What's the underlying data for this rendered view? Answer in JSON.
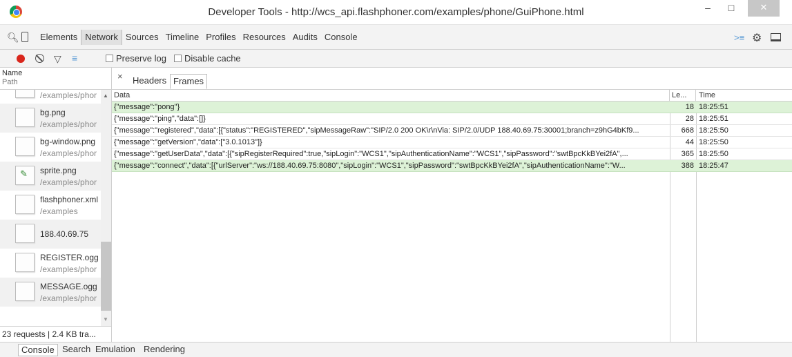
{
  "window": {
    "title": "Developer Tools - http://wcs_api.flashphoner.com/examples/phone/GuiPhone.html",
    "minimize": "–",
    "maximize": "□",
    "close": "✕"
  },
  "toolbar": {
    "tabs": [
      "Elements",
      "Network",
      "Sources",
      "Timeline",
      "Profiles",
      "Resources",
      "Audits",
      "Console"
    ],
    "active_tab": "Network"
  },
  "network_toolbar": {
    "preserve_log_label": "Preserve log",
    "disable_cache_label": "Disable cache",
    "preserve_log_checked": false,
    "disable_cache_checked": false
  },
  "request_list": {
    "header_name": "Name",
    "header_path": "Path",
    "items": [
      {
        "name": "",
        "path": "/examples/phor"
      },
      {
        "name": "bg.png",
        "path": "/examples/phor"
      },
      {
        "name": "bg-window.png",
        "path": "/examples/phor"
      },
      {
        "name": "sprite.png",
        "path": "/examples/phor"
      },
      {
        "name": "flashphoner.xml",
        "path": "/examples"
      },
      {
        "name": "188.40.69.75",
        "path": ""
      },
      {
        "name": "REGISTER.ogg",
        "path": "/examples/phor"
      },
      {
        "name": "MESSAGE.ogg",
        "path": "/examples/phor"
      }
    ],
    "status": "23 requests | 2.4 KB tra..."
  },
  "detail": {
    "close": "×",
    "tabs": [
      "Headers",
      "Frames"
    ],
    "active_tab": "Frames"
  },
  "frames": {
    "columns": [
      "Data",
      "Le...",
      "Time"
    ],
    "rows": [
      {
        "data": "{\"message\":\"pong\"}",
        "length": "18",
        "time": "18:25:51",
        "direction": "sent"
      },
      {
        "data": "{\"message\":\"ping\",\"data\":[]}",
        "length": "28",
        "time": "18:25:51",
        "direction": "received"
      },
      {
        "data": "{\"message\":\"registered\",\"data\":[{\"status\":\"REGISTERED\",\"sipMessageRaw\":\"SIP/2.0 200 OK\\r\\nVia: SIP/2.0/UDP 188.40.69.75:30001;branch=z9hG4bKf9...",
        "length": "668",
        "time": "18:25:50",
        "direction": "received"
      },
      {
        "data": "{\"message\":\"getVersion\",\"data\":[\"3.0.1013\"]}",
        "length": "44",
        "time": "18:25:50",
        "direction": "received"
      },
      {
        "data": "{\"message\":\"getUserData\",\"data\":[{\"sipRegisterRequired\":true,\"sipLogin\":\"WCS1\",\"sipAuthenticationName\":\"WCS1\",\"sipPassword\":\"swtBpcKkBYei2fA\",...",
        "length": "365",
        "time": "18:25:50",
        "direction": "received"
      },
      {
        "data": "{\"message\":\"connect\",\"data\":[{\"urlServer\":\"ws://188.40.69.75:8080\",\"sipLogin\":\"WCS1\",\"sipPassword\":\"swtBpcKkBYei2fA\",\"sipAuthenticationName\":\"W...",
        "length": "388",
        "time": "18:25:47",
        "direction": "sent"
      }
    ]
  },
  "drawer": {
    "tabs": [
      "Console",
      "Search",
      "Emulation",
      "Rendering"
    ],
    "active_tab": "Console"
  },
  "colors": {
    "sent_row": "#ddf2d7",
    "record": "#d9261c",
    "accent": "#5b9bd5"
  }
}
